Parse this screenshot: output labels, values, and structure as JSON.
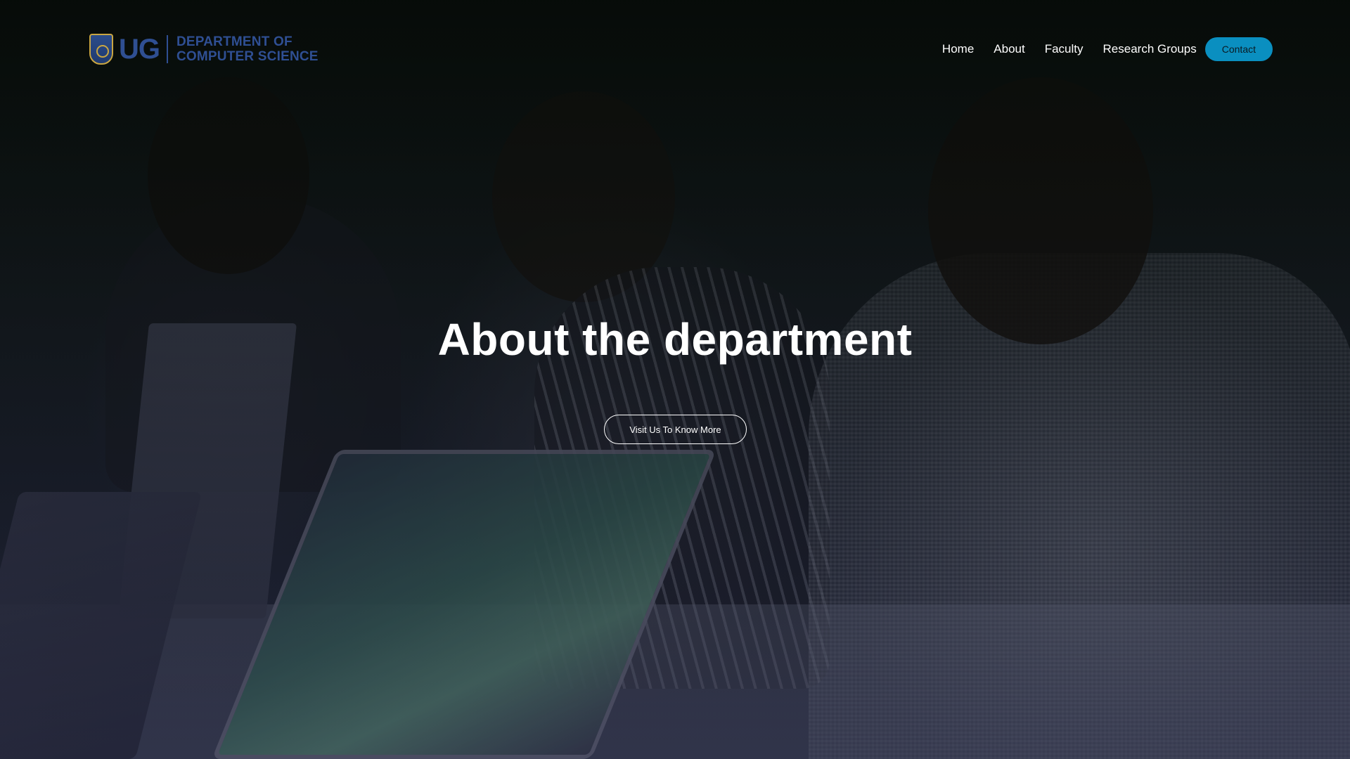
{
  "brand": {
    "crest_icon": "university-crest-icon",
    "short_name": "UG",
    "dept_line1": "DEPARTMENT OF",
    "dept_line2": "COMPUTER SCIENCE",
    "color": "#2f4f93"
  },
  "nav": {
    "items": [
      {
        "label": "Home"
      },
      {
        "label": "About"
      },
      {
        "label": "Faculty"
      },
      {
        "label": "Research Groups"
      }
    ],
    "contact_label": "Contact",
    "contact_color": "#0a8fc0"
  },
  "hero": {
    "title": "About the department",
    "cta_label": "Visit Us To Know More"
  }
}
